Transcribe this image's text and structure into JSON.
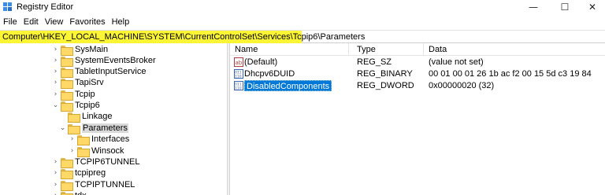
{
  "window": {
    "title": "Registry Editor",
    "minimize": "—",
    "maximize": "☐",
    "close": "✕"
  },
  "menu": [
    "File",
    "Edit",
    "View",
    "Favorites",
    "Help"
  ],
  "address": "Computer\\HKEY_LOCAL_MACHINE\\SYSTEM\\CurrentControlSet\\Services\\Tcpip6\\Parameters",
  "colors": {
    "highlight": "#fcf536",
    "selection": "#0078d7",
    "folder": "#ffd868"
  },
  "tree": [
    {
      "label": "SysMain",
      "state": "collapsed"
    },
    {
      "label": "SystemEventsBroker",
      "state": "collapsed"
    },
    {
      "label": "TabletInputService",
      "state": "collapsed"
    },
    {
      "label": "TapiSrv",
      "state": "collapsed"
    },
    {
      "label": "Tcpip",
      "state": "collapsed"
    },
    {
      "label": "Tcpip6",
      "state": "expanded"
    },
    {
      "label": "Linkage",
      "state": "leaf"
    },
    {
      "label": "Parameters",
      "state": "expanded",
      "selected": true
    },
    {
      "label": "Interfaces",
      "state": "collapsed"
    },
    {
      "label": "Winsock",
      "state": "collapsed"
    },
    {
      "label": "TCPIP6TUNNEL",
      "state": "collapsed"
    },
    {
      "label": "tcpipreg",
      "state": "collapsed"
    },
    {
      "label": "TCPIPTUNNEL",
      "state": "collapsed"
    },
    {
      "label": "tdx",
      "state": "collapsed"
    }
  ],
  "list": {
    "columns": [
      "Name",
      "Type",
      "Data"
    ],
    "rows": [
      {
        "icon": "string-value-icon",
        "name": "(Default)",
        "type": "REG_SZ",
        "data": "(value not set)"
      },
      {
        "icon": "binary-value-icon",
        "name": "Dhcpv6DUID",
        "type": "REG_BINARY",
        "data": "00 01 00 01 26 1b ac f2 00 15 5d c3 19 84"
      },
      {
        "icon": "binary-value-icon",
        "name": "DisabledComponents",
        "type": "REG_DWORD",
        "data": "0x00000020 (32)",
        "selected": true
      }
    ]
  }
}
